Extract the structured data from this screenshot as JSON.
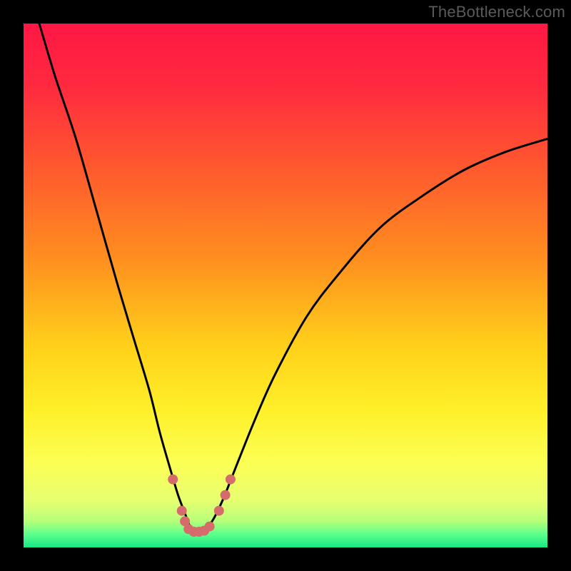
{
  "attribution": "TheBottleneck.com",
  "colors": {
    "frame": "#000000",
    "curve": "#000000",
    "markers": "#d66b6b",
    "gradient_stops": [
      {
        "offset": 0.0,
        "color": "#ff1744"
      },
      {
        "offset": 0.12,
        "color": "#ff2a3f"
      },
      {
        "offset": 0.28,
        "color": "#ff5a2e"
      },
      {
        "offset": 0.45,
        "color": "#ff8f1f"
      },
      {
        "offset": 0.62,
        "color": "#ffd21a"
      },
      {
        "offset": 0.74,
        "color": "#fff02a"
      },
      {
        "offset": 0.84,
        "color": "#fbff55"
      },
      {
        "offset": 0.91,
        "color": "#e7ff70"
      },
      {
        "offset": 0.95,
        "color": "#b6ff7a"
      },
      {
        "offset": 0.975,
        "color": "#5cff8c"
      },
      {
        "offset": 1.0,
        "color": "#17e884"
      }
    ]
  },
  "chart_data": {
    "type": "line",
    "title": "",
    "xlabel": "",
    "ylabel": "",
    "xlim": [
      0,
      100
    ],
    "ylim": [
      0,
      100
    ],
    "grid": false,
    "legend": false,
    "series": [
      {
        "name": "bottleneck-curve",
        "x": [
          3,
          6,
          10,
          14,
          18,
          21,
          24,
          26,
          28,
          29.5,
          31,
          32,
          33,
          34.5,
          36,
          38,
          40,
          44,
          48,
          54,
          60,
          68,
          76,
          84,
          92,
          100
        ],
        "y": [
          100,
          90,
          78,
          64,
          50,
          40,
          30,
          22,
          15,
          10,
          6,
          3.5,
          3,
          3.5,
          5,
          9,
          14,
          24,
          33,
          44,
          52,
          61,
          67,
          72,
          75.5,
          78
        ]
      }
    ],
    "markers": [
      {
        "x": 28.5,
        "y": 13
      },
      {
        "x": 30.2,
        "y": 7
      },
      {
        "x": 30.8,
        "y": 5
      },
      {
        "x": 31.5,
        "y": 3.5
      },
      {
        "x": 32.5,
        "y": 3
      },
      {
        "x": 33.5,
        "y": 3
      },
      {
        "x": 34.5,
        "y": 3.2
      },
      {
        "x": 35.5,
        "y": 4
      },
      {
        "x": 37.3,
        "y": 7
      },
      {
        "x": 38.5,
        "y": 10
      },
      {
        "x": 39.5,
        "y": 13
      }
    ]
  }
}
